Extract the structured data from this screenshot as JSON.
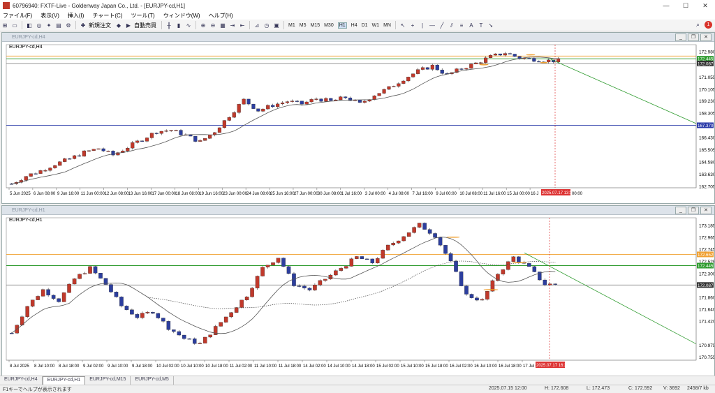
{
  "window": {
    "title": "60796940: FXTF-Live - Goldenway Japan Co., Ltd. - [EURJPY-cd,H1]",
    "min": "—",
    "max": "☐",
    "close": "✕"
  },
  "menu": [
    "ファイル(F)",
    "表示(V)",
    "挿入(I)",
    "チャート(C)",
    "ツール(T)",
    "ウィンドウ(W)",
    "ヘルプ(H)"
  ],
  "toolbar": {
    "new_order": "新規注文",
    "auto_trading": "自動売買",
    "timeframes": [
      "M1",
      "M5",
      "M15",
      "M30",
      "H1",
      "H4",
      "D1",
      "W1",
      "MN"
    ],
    "active_timeframe": "H1",
    "notifications": "1"
  },
  "top_chart": {
    "window_title": "EURJPY-cd,H4",
    "label": "EURJPY-cd,H4",
    "price_labels": [
      "172.980",
      "171.055",
      "170.105",
      "169.230",
      "168.305",
      "166.430",
      "165.505",
      "164.580",
      "163.630",
      "162.705"
    ],
    "tags": {
      "green": "172.445",
      "dark": "172.087",
      "blue": "167.370"
    },
    "date_labels": [
      "5 Jun 2025",
      "6 Jun 08:00",
      "9 Jun 16:00",
      "11 Jun 00:00",
      "12 Jun 08:00",
      "13 Jun 16:00",
      "17 Jun 00:00",
      "18 Jun 08:00",
      "19 Jun 16:00",
      "23 Jun 00:00",
      "24 Jun 08:00",
      "25 Jun 16:00",
      "27 Jun 00:00",
      "30 Jun 08:00",
      "1 Jul 16:00",
      "3 Jul 00:00",
      "4 Jul 08:00",
      "7 Jul 16:00",
      "9 Jul 00:00",
      "10 Jul 08:00",
      "11 Jul 16:00",
      "15 Jul 00:00",
      "16 J"
    ],
    "date_tag": "2025.07.17 13:38",
    "date_tail": "00:00"
  },
  "bottom_chart": {
    "window_title": "EURJPY-cd,H1",
    "label": "EURJPY-cd,H1",
    "price_labels": [
      "173.185",
      "172.965",
      "172.745",
      "172.525",
      "172.300",
      "171.860",
      "171.640",
      "171.420",
      "170.975",
      "170.755"
    ],
    "tags": {
      "orange": "172.652",
      "green": "172.445",
      "dark": "172.087"
    },
    "date_labels": [
      "8 Jul 2025",
      "8 Jul 10:00",
      "8 Jul 18:00",
      "9 Jul 02:00",
      "9 Jul 10:00",
      "9 Jul 18:00",
      "10 Jul 02:00",
      "10 Jul 10:00",
      "10 Jul 18:00",
      "11 Jul 02:00",
      "11 Jul 10:00",
      "11 Jul 18:00",
      "14 Jul 02:00",
      "14 Jul 10:00",
      "14 Jul 18:00",
      "15 Jul 02:00",
      "15 Jul 10:00",
      "15 Jul 18:00",
      "16 Jul 02:00",
      "16 Jul 10:00",
      "16 Jul 18:00",
      "17 Jul 02:00"
    ],
    "date_tag": "2025.07.17 16:38"
  },
  "tabs": [
    "EURJPY-cd,H4",
    "EURJPY-cd,H1",
    "EURJPY-cd,M15",
    "EURJPY-cd,M5"
  ],
  "active_tab": "EURJPY-cd,H1",
  "status": {
    "help": "F1キーでヘルプが表示されます",
    "time": "2025.07.15 12:00",
    "high": "H: 172.608",
    "low": "L: 172.473",
    "close": "C: 172.592",
    "volume": "V: 3692",
    "kb": "2458/7 kb"
  },
  "chart_data": [
    {
      "type": "candlestick",
      "title": "EURJPY-cd,H4",
      "ylim": [
        162.6,
        173.2
      ],
      "ytick_labels": [
        "172.980",
        "171.055",
        "170.105",
        "169.230",
        "168.305",
        "166.430",
        "165.505",
        "164.580",
        "163.630",
        "162.705"
      ],
      "horizontal_lines": [
        {
          "color": "#f0a030",
          "value": 172.65
        },
        {
          "color": "#2e9b2e",
          "value": 172.445
        },
        {
          "color": "#888888",
          "value": 172.087
        },
        {
          "color": "#2a3aa8",
          "value": 167.37
        }
      ],
      "trendline_color": "#2e9b2e",
      "series": [
        {
          "name": "price",
          "close_path": [
            162.9,
            163.5,
            163.9,
            164.4,
            164.8,
            165.3,
            165.6,
            165.1,
            165.7,
            166.3,
            166.9,
            167.0,
            166.6,
            166.1,
            166.9,
            168.1,
            169.3,
            168.5,
            168.9,
            169.2,
            169.0,
            169.4,
            169.2,
            169.5,
            169.0,
            169.7,
            170.2,
            170.9,
            171.5,
            171.9,
            171.2,
            171.7,
            172.1,
            172.6,
            172.9,
            172.5,
            172.4,
            172.3
          ]
        }
      ]
    },
    {
      "type": "candlestick",
      "title": "EURJPY-cd,H1",
      "ylim": [
        170.7,
        173.25
      ],
      "ytick_labels": [
        "173.185",
        "172.965",
        "172.745",
        "172.525",
        "172.300",
        "171.860",
        "171.640",
        "171.420",
        "170.975",
        "170.755"
      ],
      "horizontal_lines": [
        {
          "color": "#f0a030",
          "value": 172.652
        },
        {
          "color": "#2e9b2e",
          "value": 172.445
        },
        {
          "color": "#888888",
          "value": 172.087
        }
      ],
      "trendline_color": "#2e9b2e",
      "series": [
        {
          "name": "price",
          "close_path": [
            171.2,
            171.7,
            172.0,
            171.8,
            172.2,
            172.4,
            172.1,
            171.7,
            171.5,
            171.6,
            171.3,
            171.1,
            171.0,
            171.3,
            171.6,
            171.9,
            172.4,
            172.6,
            172.1,
            172.0,
            172.2,
            172.4,
            172.6,
            172.5,
            172.8,
            173.0,
            173.2,
            173.0,
            172.5,
            171.9,
            171.8,
            172.3,
            172.6,
            172.4,
            172.1
          ]
        }
      ]
    }
  ]
}
